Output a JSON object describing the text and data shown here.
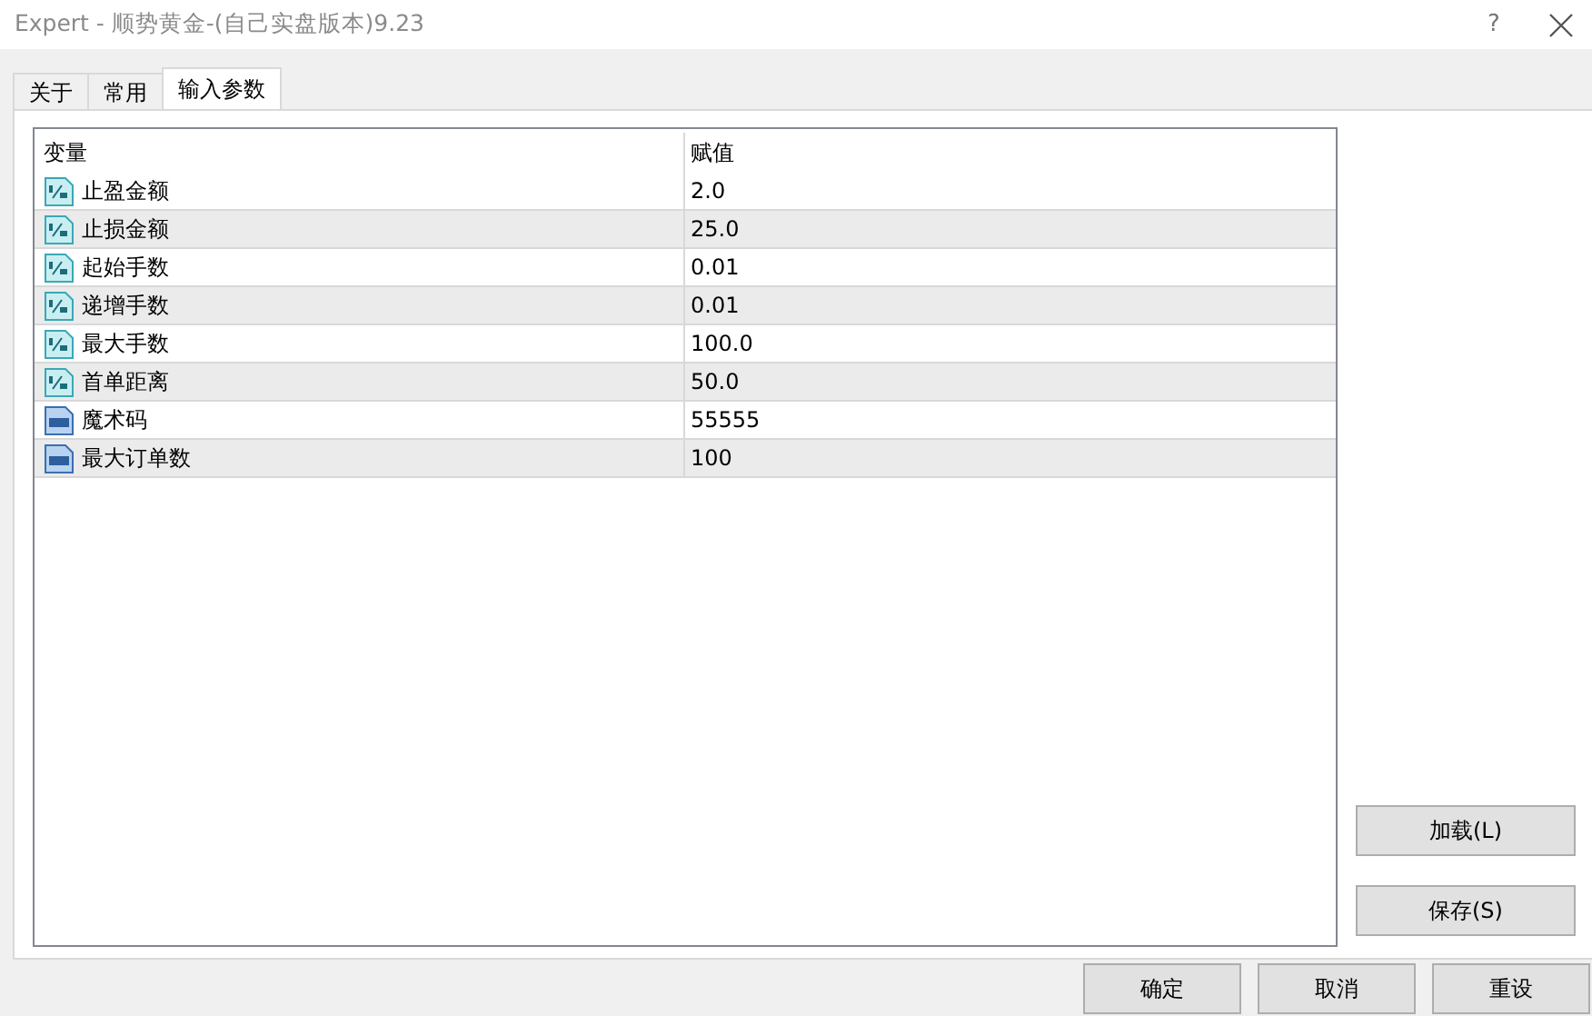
{
  "window": {
    "title": "Expert - 顺势黄金-(自己实盘版本)9.23",
    "help": "?"
  },
  "tabs": [
    {
      "label": "关于",
      "selected": false
    },
    {
      "label": "常用",
      "selected": false
    },
    {
      "label": "输入参数",
      "selected": true
    }
  ],
  "table": {
    "columns": [
      "变量",
      "赋值"
    ],
    "rows": [
      {
        "kind": "double",
        "name": "止盈金额",
        "value": "2.0"
      },
      {
        "kind": "double",
        "name": "止损金额",
        "value": "25.0"
      },
      {
        "kind": "double",
        "name": "起始手数",
        "value": "0.01"
      },
      {
        "kind": "double",
        "name": "递增手数",
        "value": "0.01"
      },
      {
        "kind": "double",
        "name": "最大手数",
        "value": "100.0"
      },
      {
        "kind": "double",
        "name": "首单距离",
        "value": "50.0"
      },
      {
        "kind": "int",
        "name": "魔术码",
        "value": "55555"
      },
      {
        "kind": "int",
        "name": "最大订单数",
        "value": "100"
      }
    ]
  },
  "side_buttons": [
    "加载(L)",
    "保存(S)"
  ],
  "buttons": [
    "确定",
    "取消",
    "重设"
  ]
}
